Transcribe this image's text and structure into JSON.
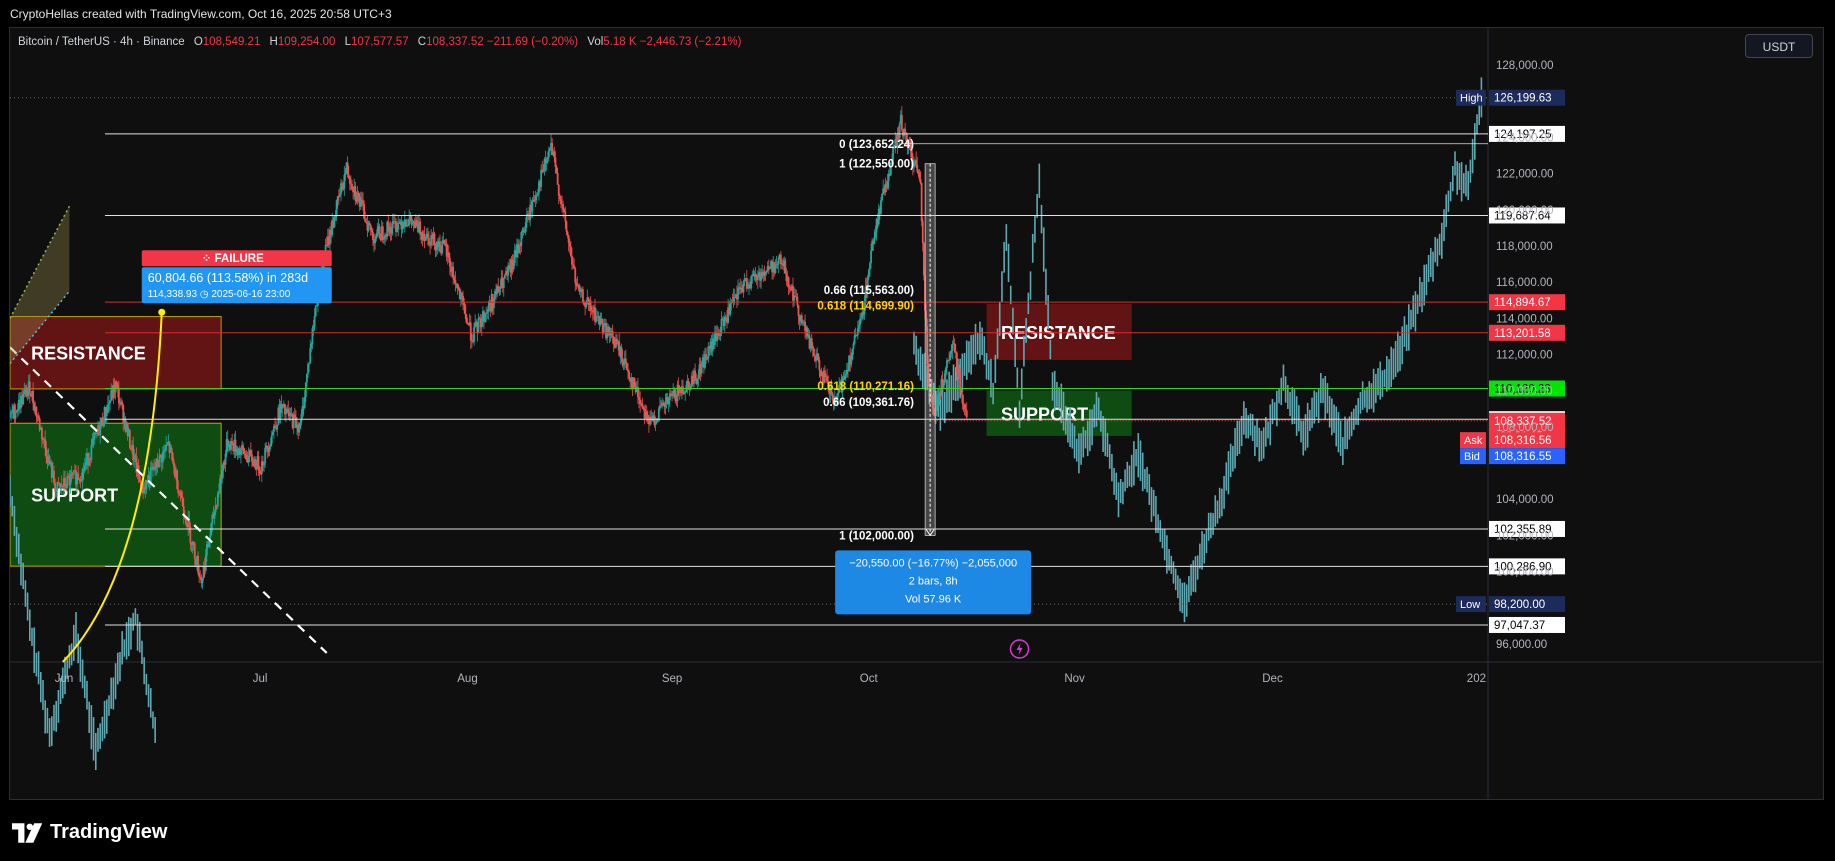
{
  "header": {
    "credit": "CryptoHellas created with TradingView.com, Oct 16, 2025 20:58 UTC+3"
  },
  "legend": {
    "symbol": "Bitcoin / TetherUS · 4h · Binance",
    "o_label": "O",
    "o": "108,549.21",
    "h_label": "H",
    "h": "109,254.00",
    "l_label": "L",
    "l": "107,577.57",
    "c_label": "C",
    "c": "108,337.52",
    "change": "−211.69 (−0.20%)",
    "vol_label": "Vol",
    "vol": "5.18 K",
    "vol_change": "−2,446.73 (−2.21%)"
  },
  "currency_button": "USDT",
  "brand": "TradingView",
  "colors": {
    "up": "#26a69a",
    "down": "#ef5350",
    "cyan_line": "#5fa9b3",
    "resistance_fill": "#7a1414",
    "support_fill": "#0e5e12",
    "label_red": "#f23645",
    "label_green": "#00e600",
    "label_blue": "#2962ff",
    "label_navy": "#1c2a5c",
    "fail_red": "#f23645",
    "info_blue": "#2196f3"
  },
  "chart_data": {
    "type": "candlestick",
    "title": "Bitcoin / TetherUS · 4h · Binance",
    "ylim": [
      95000,
      129500
    ],
    "xlim": [
      "2025-05-24",
      "2026-01-03"
    ],
    "y_ticks": [
      "96,000.00",
      "100,000.00",
      "102,000.00",
      "104,000.00",
      "108,000.00",
      "110,000.00",
      "112,000.00",
      "114,000.00",
      "116,000.00",
      "118,000.00",
      "120,000.00",
      "122,000.00",
      "124,000.00",
      "128,000.00"
    ],
    "x_ticks": [
      {
        "label": "Jun",
        "date": "2025-06-01"
      },
      {
        "label": "Jul",
        "date": "2025-07-01"
      },
      {
        "label": "Aug",
        "date": "2025-08-01"
      },
      {
        "label": "Sep",
        "date": "2025-09-01"
      },
      {
        "label": "Oct",
        "date": "2025-10-01"
      },
      {
        "label": "Nov",
        "date": "2025-11-01"
      },
      {
        "label": "Dec",
        "date": "2025-12-01"
      },
      {
        "label": "202",
        "date": "2026-01-01"
      }
    ],
    "price_path": [
      [
        "2025-05-24",
        108500
      ],
      [
        "2025-05-27",
        110200
      ],
      [
        "2025-05-31",
        104500
      ],
      [
        "2025-06-04",
        105500
      ],
      [
        "2025-06-09",
        110300
      ],
      [
        "2025-06-13",
        104500
      ],
      [
        "2025-06-17",
        107000
      ],
      [
        "2025-06-22",
        99500
      ],
      [
        "2025-06-26",
        107200
      ],
      [
        "2025-07-01",
        105800
      ],
      [
        "2025-07-04",
        109000
      ],
      [
        "2025-07-07",
        108000
      ],
      [
        "2025-07-10",
        116500
      ],
      [
        "2025-07-14",
        122300
      ],
      [
        "2025-07-18",
        118500
      ],
      [
        "2025-07-23",
        119500
      ],
      [
        "2025-07-29",
        117800
      ],
      [
        "2025-08-02",
        113000
      ],
      [
        "2025-08-08",
        116800
      ],
      [
        "2025-08-14",
        123500
      ],
      [
        "2025-08-18",
        115500
      ],
      [
        "2025-08-24",
        112500
      ],
      [
        "2025-08-29",
        108200
      ],
      [
        "2025-09-01",
        109500
      ],
      [
        "2025-09-05",
        110800
      ],
      [
        "2025-09-12",
        115800
      ],
      [
        "2025-09-18",
        117200
      ],
      [
        "2025-09-22",
        112800
      ],
      [
        "2025-09-26",
        109200
      ],
      [
        "2025-09-30",
        113800
      ],
      [
        "2025-10-02",
        118800
      ],
      [
        "2025-10-06",
        124800
      ],
      [
        "2025-10-09",
        121500
      ],
      [
        "2025-10-10",
        111500
      ],
      [
        "2025-10-11",
        108800
      ],
      [
        "2025-10-14",
        112500
      ],
      [
        "2025-10-16",
        108340
      ]
    ],
    "projection_path": [
      [
        "2025-05-24",
        104500
      ],
      [
        "2025-05-27",
        97000
      ],
      [
        "2025-05-30",
        91000
      ],
      [
        "2025-06-03",
        96500
      ],
      [
        "2025-06-06",
        90000
      ],
      [
        "2025-06-10",
        95500
      ],
      [
        "2025-06-12",
        97500
      ],
      [
        "2025-06-15",
        91000
      ],
      [
        "2025-10-08",
        112500
      ],
      [
        "2025-10-12",
        109000
      ],
      [
        "2025-10-16",
        111500
      ],
      [
        "2025-10-18",
        113000
      ],
      [
        "2025-10-20",
        110000
      ],
      [
        "2025-10-22",
        118500
      ],
      [
        "2025-10-24",
        109000
      ],
      [
        "2025-10-26",
        117500
      ],
      [
        "2025-10-27",
        121500
      ],
      [
        "2025-10-29",
        110500
      ],
      [
        "2025-11-02",
        106500
      ],
      [
        "2025-11-05",
        109000
      ],
      [
        "2025-11-08",
        104000
      ],
      [
        "2025-11-11",
        106500
      ],
      [
        "2025-11-15",
        101500
      ],
      [
        "2025-11-18",
        98200
      ],
      [
        "2025-11-21",
        101500
      ],
      [
        "2025-11-24",
        104500
      ],
      [
        "2025-11-27",
        108500
      ],
      [
        "2025-11-30",
        107000
      ],
      [
        "2025-12-03",
        110500
      ],
      [
        "2025-12-06",
        107500
      ],
      [
        "2025-12-09",
        110000
      ],
      [
        "2025-12-12",
        107000
      ],
      [
        "2025-12-15",
        109500
      ],
      [
        "2025-12-18",
        110500
      ],
      [
        "2025-12-21",
        112500
      ],
      [
        "2025-12-24",
        115500
      ],
      [
        "2025-12-27",
        118500
      ],
      [
        "2025-12-29",
        122300
      ],
      [
        "2025-12-31",
        121000
      ],
      [
        "2026-01-01",
        124000
      ],
      [
        "2026-01-02",
        126199.63
      ]
    ],
    "horizontal_levels": [
      {
        "price": 124197.25,
        "label": "124,197.25",
        "style": "white"
      },
      {
        "price": 119687.64,
        "label": "119,687.64",
        "style": "white"
      },
      {
        "price": 114894.67,
        "label": "114,894.67",
        "style": "red"
      },
      {
        "price": 113201.58,
        "label": "113,201.58",
        "style": "red"
      },
      {
        "price": 110120.23,
        "label": "110,120.23",
        "style": "green"
      },
      {
        "price": 108424.7,
        "label": "108,424.70",
        "style": "white"
      },
      {
        "price": 102355.89,
        "label": "102,355.89",
        "style": "white"
      },
      {
        "price": 100286.9,
        "label": "100,286.90",
        "style": "white"
      },
      {
        "price": 97047.37,
        "label": "97,047.37",
        "style": "white"
      }
    ],
    "high": {
      "label": "High",
      "price": 126199.63,
      "value": "126,199.63"
    },
    "low": {
      "label": "Low",
      "price": 98200.0,
      "value": "98,200.00"
    },
    "last": {
      "price": 108337.52,
      "value": "108,337.52",
      "countdown": "02:01:15"
    },
    "ask": {
      "label": "Ask",
      "price": 108316.56,
      "value": "108,316.56"
    },
    "bid": {
      "label": "Bid",
      "value": "108,316.55"
    },
    "zones": [
      {
        "label": "RESISTANCE",
        "x0": "2025-05-24",
        "x1": "2025-06-25",
        "top": 114100,
        "bottom": 110100,
        "kind": "resistance"
      },
      {
        "label": "SUPPORT",
        "x0": "2025-05-24",
        "x1": "2025-06-25",
        "top": 108200,
        "bottom": 100300,
        "kind": "support"
      },
      {
        "label": "RESISTANCE",
        "x0": "2025-10-19",
        "x1": "2025-11-10",
        "top": 114800,
        "bottom": 111700,
        "kind": "resistance"
      },
      {
        "label": "SUPPORT",
        "x0": "2025-10-19",
        "x1": "2025-11-10",
        "top": 110000,
        "bottom": 107500,
        "kind": "support"
      }
    ],
    "fib_labels": [
      {
        "text": "0 (123,652.24)",
        "price": 123652.24,
        "color": "#ffffff"
      },
      {
        "text": "1 (122,550.00)",
        "price": 122550,
        "color": "#ffffff"
      },
      {
        "text": "0.66 (115,563.00)",
        "price": 115563,
        "color": "#ffffff"
      },
      {
        "text": "0.618 (114,699.90)",
        "price": 114699.9,
        "color": "#ffd600"
      },
      {
        "text": "0.618 (110,271.16)",
        "price": 110271.16,
        "color": "#ffd600"
      },
      {
        "text": "0.66 (109,361.76)",
        "price": 109361.76,
        "color": "#ffffff"
      },
      {
        "text": "1 (102,000.00)",
        "price": 102000,
        "color": "#ffffff"
      }
    ],
    "failure_tag": {
      "title": "FAILURE",
      "line1": "60,804.66 (113.58%) in 283d",
      "line2": "114,338.93",
      "line3": "2025-06-16  23:00",
      "date": "2025-06-16",
      "price": 114338.93
    },
    "measure_box": {
      "line1": "−20,550.00 (−16.77%) −2,055,000",
      "line2": "2 bars, 8h",
      "line3": "Vol 57.96 K",
      "top_price": 122550,
      "bottom_price": 102000,
      "date": "2025-10-10"
    }
  }
}
